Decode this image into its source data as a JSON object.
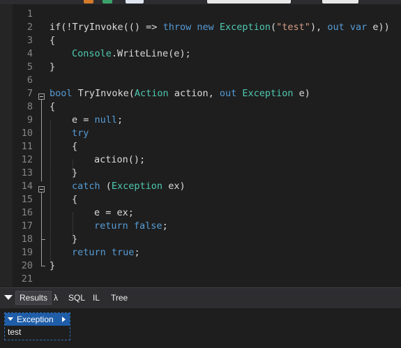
{
  "results_tabs": [
    {
      "label": "Results",
      "active": true
    },
    {
      "label": "λ",
      "active": false
    },
    {
      "label": "SQL",
      "active": false
    },
    {
      "label": "IL",
      "active": false
    },
    {
      "label": "Tree",
      "active": false
    }
  ],
  "output": {
    "type_header": "Exception",
    "value": "test"
  },
  "code": {
    "line_numbers": [
      "1",
      "2",
      "3",
      "4",
      "5",
      "6",
      "7",
      "8",
      "9",
      "10",
      "11",
      "12",
      "13",
      "14",
      "15",
      "16",
      "17",
      "18",
      "19",
      "20",
      "21"
    ],
    "l2": {
      "a": "if(!TryInvoke(() => ",
      "b": "throw",
      "c": " ",
      "d": "new",
      "e": " ",
      "f": "Exception",
      "g": "(",
      "h": "\"test\"",
      "i": "), ",
      "j": "out",
      "k": " ",
      "l": "var",
      "m": " e))"
    },
    "l3": "{",
    "l4": {
      "a": "Console",
      "b": ".WriteLine(e);"
    },
    "l5": "}",
    "l7": {
      "a": "bool",
      "b": " TryInvoke(",
      "c": "Action",
      "d": " action, ",
      "e": "out",
      "f": " ",
      "g": "Exception",
      "h": " e)"
    },
    "l8": "{",
    "l9": {
      "a": "e = ",
      "b": "null",
      "c": ";"
    },
    "l10": "try",
    "l11": "{",
    "l12": "action();",
    "l13": "}",
    "l14": {
      "a": "catch",
      "b": " (",
      "c": "Exception",
      "d": " ex)"
    },
    "l15": "{",
    "l16": "e = ex;",
    "l17": {
      "a": "return",
      "b": " ",
      "c": "false",
      "d": ";"
    },
    "l18": "}",
    "l19": {
      "a": "return",
      "b": " ",
      "c": "true",
      "d": ";"
    },
    "l20": "}"
  },
  "colors": {
    "keyword": "#569cd6",
    "type": "#4ec9b0",
    "string": "#d69d85",
    "text": "#dcdcdc",
    "line_number": "#858585",
    "accent": "#1f5da8"
  }
}
